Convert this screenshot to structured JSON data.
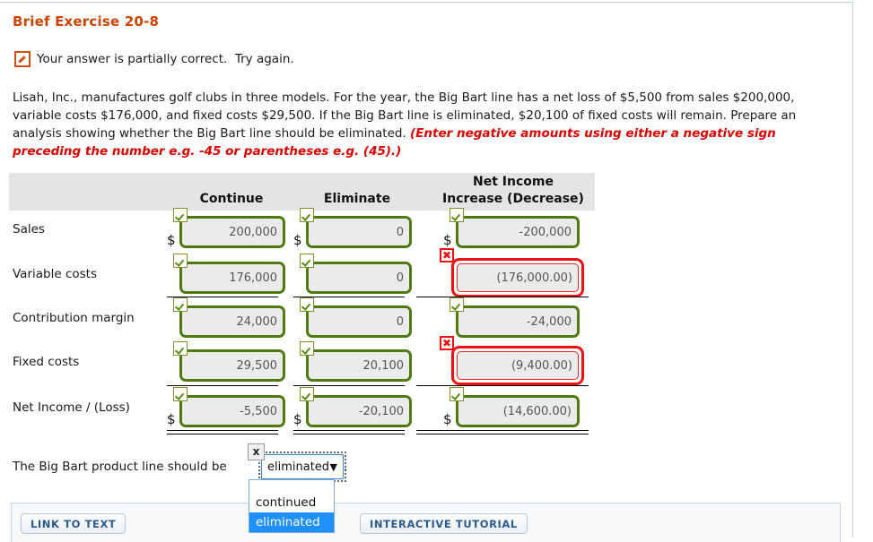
{
  "exercise": {
    "title": "Brief Exercise 20-8"
  },
  "status": {
    "icon": "partially-correct-icon",
    "message": "Your answer is partially correct.  Try again."
  },
  "problem": {
    "body": "Lisah, Inc., manufactures golf clubs in three models. For the year, the Big Bart line has a net loss of $5,500 from sales $200,000, variable costs $176,000, and fixed costs $29,500. If the Big Bart line is eliminated, $20,100 of fixed costs will remain. Prepare an analysis showing whether the Big Bart line should be eliminated. ",
    "note": "(Enter negative amounts using either a negative sign preceding the number e.g. -45 or parentheses e.g. (45).)"
  },
  "table": {
    "headers": {
      "blank": "",
      "continue": "Continue",
      "eliminate": "Eliminate",
      "net_income_line1": "Net Income",
      "net_income_line2": "Increase (Decrease)"
    },
    "rows": [
      {
        "label": "Sales",
        "continue": {
          "value": "200,000",
          "state": "correct",
          "dollar": "$"
        },
        "eliminate": {
          "value": "0",
          "state": "correct",
          "dollar": "$"
        },
        "net": {
          "value": "-200,000",
          "state": "correct",
          "dollar": "$"
        }
      },
      {
        "label": "Variable costs",
        "continue": {
          "value": "176,000",
          "state": "correct",
          "dollar": ""
        },
        "eliminate": {
          "value": "0",
          "state": "correct",
          "dollar": ""
        },
        "net": {
          "value": "(176,000.00)",
          "state": "incorrect",
          "dollar": ""
        }
      },
      {
        "label": "Contribution margin",
        "continue": {
          "value": "24,000",
          "state": "correct",
          "dollar": ""
        },
        "eliminate": {
          "value": "0",
          "state": "correct",
          "dollar": ""
        },
        "net": {
          "value": "-24,000",
          "state": "correct",
          "dollar": ""
        }
      },
      {
        "label": "Fixed costs",
        "continue": {
          "value": "29,500",
          "state": "correct",
          "dollar": ""
        },
        "eliminate": {
          "value": "20,100",
          "state": "correct",
          "dollar": ""
        },
        "net": {
          "value": "(9,400.00)",
          "state": "incorrect",
          "dollar": ""
        }
      },
      {
        "label": "Net Income / (Loss)",
        "continue": {
          "value": "-5,500",
          "state": "correct",
          "dollar": "$"
        },
        "eliminate": {
          "value": "-20,100",
          "state": "correct",
          "dollar": "$"
        },
        "net": {
          "value": "(14,600.00)",
          "state": "correct",
          "dollar": "$"
        }
      }
    ]
  },
  "conclusion": {
    "text": "The Big Bart product line should be",
    "trailing": ".",
    "badge": "x",
    "select": {
      "value": "eliminated",
      "caret": "▼",
      "options": [
        "continued",
        "eliminated"
      ],
      "selected_index": 1
    }
  },
  "footer": {
    "link_to_text": "LINK TO TEXT",
    "interactive_tutorial": "INTERACTIVE TUTORIAL"
  },
  "colors": {
    "title": "#cc4400",
    "note": "#e00000",
    "correct_border": "#4f7a10",
    "error_border": "#ee1111",
    "header_bg": "#e4e4e4",
    "select_highlight": "#1e90ff"
  }
}
